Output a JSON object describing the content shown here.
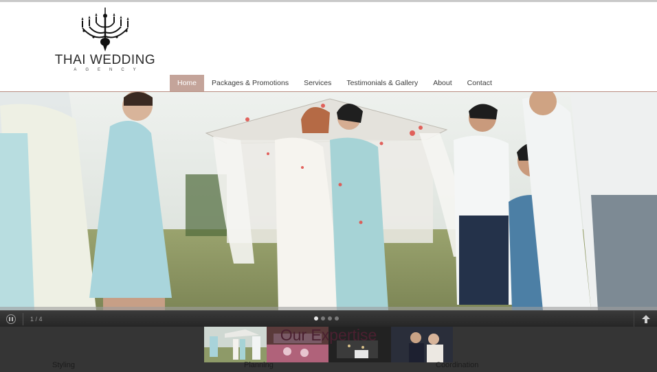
{
  "brand": {
    "title": "THAI WEDDING",
    "subtitle": "AGENCY",
    "logo_icon": "chandelier-icon"
  },
  "nav": {
    "items": [
      {
        "label": "Home",
        "active": true
      },
      {
        "label": "Packages & Promotions",
        "active": false
      },
      {
        "label": "Services",
        "active": false
      },
      {
        "label": "Testimonials & Gallery",
        "active": false
      },
      {
        "label": "About",
        "active": false
      },
      {
        "label": "Contact",
        "active": false
      }
    ]
  },
  "slider": {
    "counter": "1 / 4",
    "current_slide": 1,
    "total_slides": 4,
    "pause_icon": "pause-icon",
    "scroll_top_icon": "arrow-up-icon"
  },
  "expertise": {
    "heading": "Our Expertise",
    "items": [
      "Styling",
      "Planning",
      "Coordination"
    ]
  },
  "colors": {
    "nav_active_bg": "#c4a49a",
    "control_bar": "#2e2e2e",
    "lower_bg": "#353535",
    "heading": "#4a2030"
  }
}
